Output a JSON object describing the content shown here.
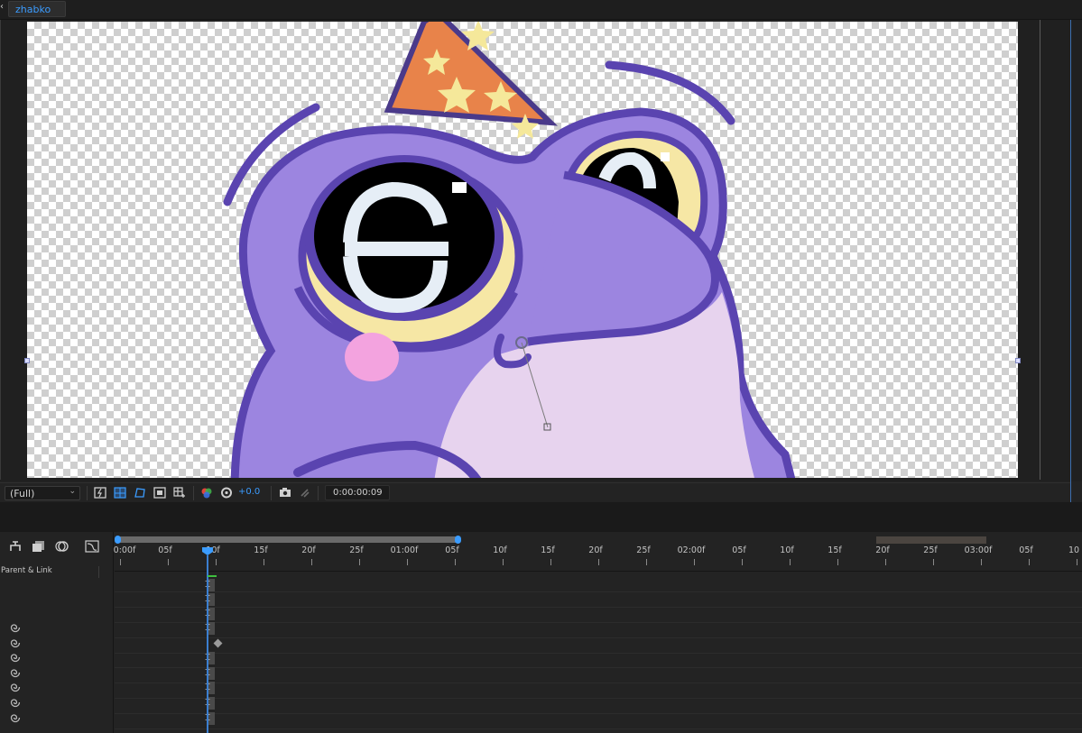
{
  "composition": {
    "tab_name": "zhabko"
  },
  "viewer": {
    "magnification": "(Full)",
    "exposure": "+0.0",
    "current_time": "0:00:00:09"
  },
  "timeline": {
    "parent_link_header": "Parent & Link",
    "ruler_labels": [
      "0:00f",
      "05f",
      "10f",
      "15f",
      "20f",
      "25f",
      "01:00f",
      "05f",
      "10f",
      "15f",
      "20f",
      "25f",
      "02:00f",
      "05f",
      "10f",
      "15f",
      "20f",
      "25f",
      "03:00f",
      "05f",
      "10"
    ],
    "current_frame_label": "10f",
    "layer_count_with_pickwhip": 7
  },
  "colors": {
    "accent": "#3b9cff",
    "frog_body": "#9c85e0",
    "frog_outline": "#5a44b0",
    "frog_belly": "#e7d3ee",
    "hat": "#e8834a",
    "stars": "#f5e89a",
    "cheek": "#f3a3df"
  }
}
